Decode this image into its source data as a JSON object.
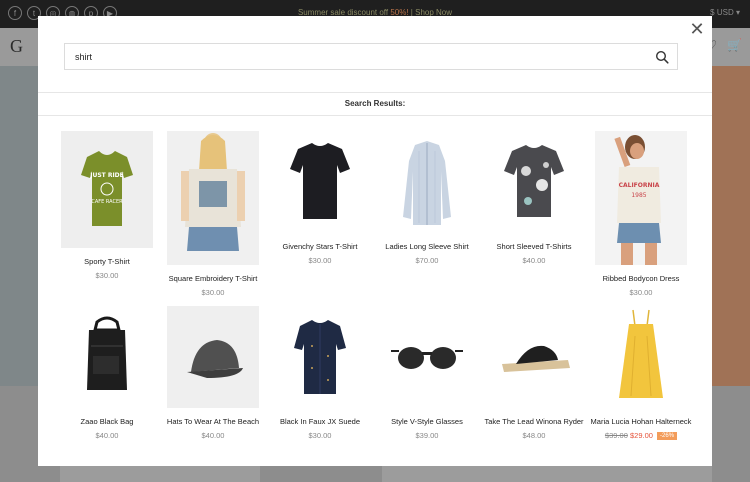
{
  "topbar": {
    "promo_text": "Summer sale discount off",
    "promo_highlight": "50%!",
    "promo_link": "Shop Now",
    "currency": "USD"
  },
  "header": {
    "logo_letter": "G"
  },
  "search": {
    "value": "shirt",
    "results_label": "Search Results:"
  },
  "products": [
    {
      "name": "Sporty T-Shirt",
      "price": "$30.00"
    },
    {
      "name": "Square Embroidery T-Shirt",
      "price": "$30.00"
    },
    {
      "name": "Givenchy Stars T-Shirt",
      "price": "$30.00"
    },
    {
      "name": "Ladies Long Sleeve Shirt",
      "price": "$70.00"
    },
    {
      "name": "Short Sleeved T-Shirts",
      "price": "$40.00"
    },
    {
      "name": "Ribbed Bodycon Dress",
      "price": "$30.00"
    },
    {
      "name": "Zaao Black Bag",
      "price": "$40.00"
    },
    {
      "name": "Hats To Wear At The Beach",
      "price": "$40.00"
    },
    {
      "name": "Black In Faux JX Suede",
      "price": "$30.00"
    },
    {
      "name": "Style V-Style Glasses",
      "price": "$39.00"
    },
    {
      "name": "Take The Lead Winona Ryder",
      "price": "$48.00"
    },
    {
      "name": "Maria Lucia Hohan Halterneck",
      "old_price": "$39.00",
      "sale_price": "$29.00",
      "badge": "-26%"
    }
  ],
  "colors": {
    "accent": "#f39c5a",
    "sale": "#e5543b"
  }
}
